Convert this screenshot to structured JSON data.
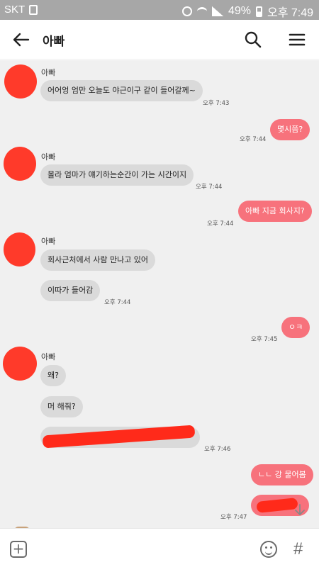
{
  "status_bar": {
    "carrier": "SKT",
    "battery": "49%",
    "time": "오후 7:49"
  },
  "header": {
    "title": "아빠"
  },
  "messages": [
    {
      "side": "in",
      "sender": "아빠",
      "text": "어어엉 엄만 오늘도 야근이구 같이 들어갈께~",
      "time": "오후 7:43"
    },
    {
      "side": "out",
      "text": "몇시쯤?",
      "time": "오후 7:44"
    },
    {
      "side": "in",
      "sender": "아빠",
      "text": "몰라 엄마가 얘기하는순간이 가는 시간이지",
      "time": "오후 7:44"
    },
    {
      "side": "out",
      "text": "아빠 지금 회사지?",
      "time": "오후 7:44"
    },
    {
      "side": "in",
      "sender": "아빠",
      "text": "회사근처에서 사람 만나고 있어"
    },
    {
      "side": "in",
      "text": "이따가 들어감",
      "time": "오후 7:44"
    },
    {
      "side": "out",
      "text": "ㅇㅋ",
      "time": "오후 7:45"
    },
    {
      "side": "in",
      "sender": "아빠",
      "text": "왜?"
    },
    {
      "side": "in",
      "text": "머 해줘?"
    },
    {
      "side": "in",
      "text": "",
      "redacted": true,
      "time": "오후 7:46"
    },
    {
      "side": "out",
      "text": "ㄴㄴ 강 물어봄"
    },
    {
      "side": "out",
      "text": "",
      "redacted": true,
      "time": "오후 7:47"
    }
  ],
  "colors": {
    "outgoing_bubble": "#f7727c",
    "incoming_bubble": "#dadada",
    "chat_background": "#f0f0f0",
    "status_bar": "#a7a7a7"
  },
  "icons": {
    "back": "arrow-left-icon",
    "search": "search-icon",
    "menu": "hamburger-menu-icon",
    "plus": "plus-box-icon",
    "emoji": "emoji-icon",
    "hash": "hash-icon",
    "scroll_down": "chevron-down-icon"
  },
  "bottom_bar": {
    "plus_label": "+",
    "hash_label": "#"
  }
}
